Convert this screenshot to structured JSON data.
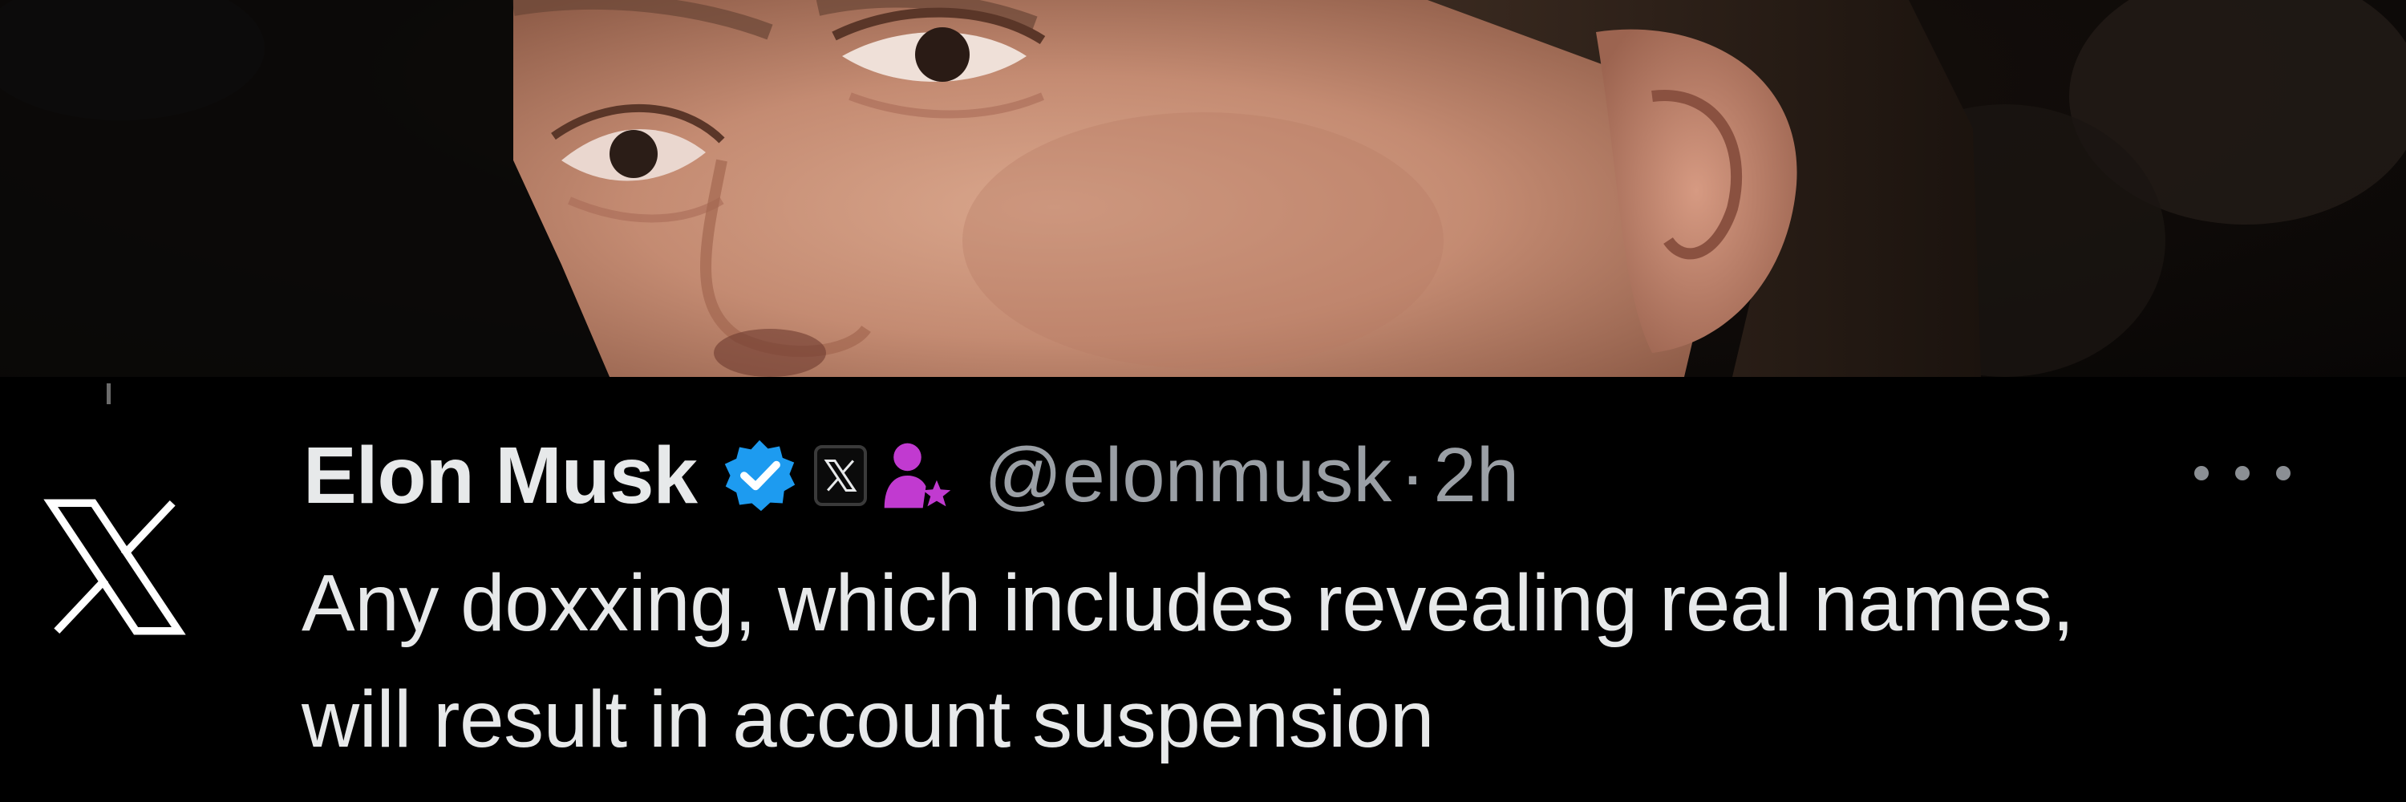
{
  "tweet": {
    "display_name": "Elon Musk",
    "handle": "@elonmusk",
    "separator": "·",
    "timestamp": "2h",
    "text": "Any doxxing, which includes revealing real names, will result in account suspension"
  },
  "icons": {
    "platform_logo": "x-logo-icon",
    "verified": "verified-badge-icon",
    "affiliation": "x-affiliation-badge-icon",
    "role": "person-star-icon",
    "menu": "more-options-icon"
  },
  "colors": {
    "background": "#000000",
    "primary_text": "#e7e9ea",
    "secondary_text": "#9a9fa5",
    "verified_blue": "#1d9bf0",
    "role_magenta": "#c13ad0"
  }
}
